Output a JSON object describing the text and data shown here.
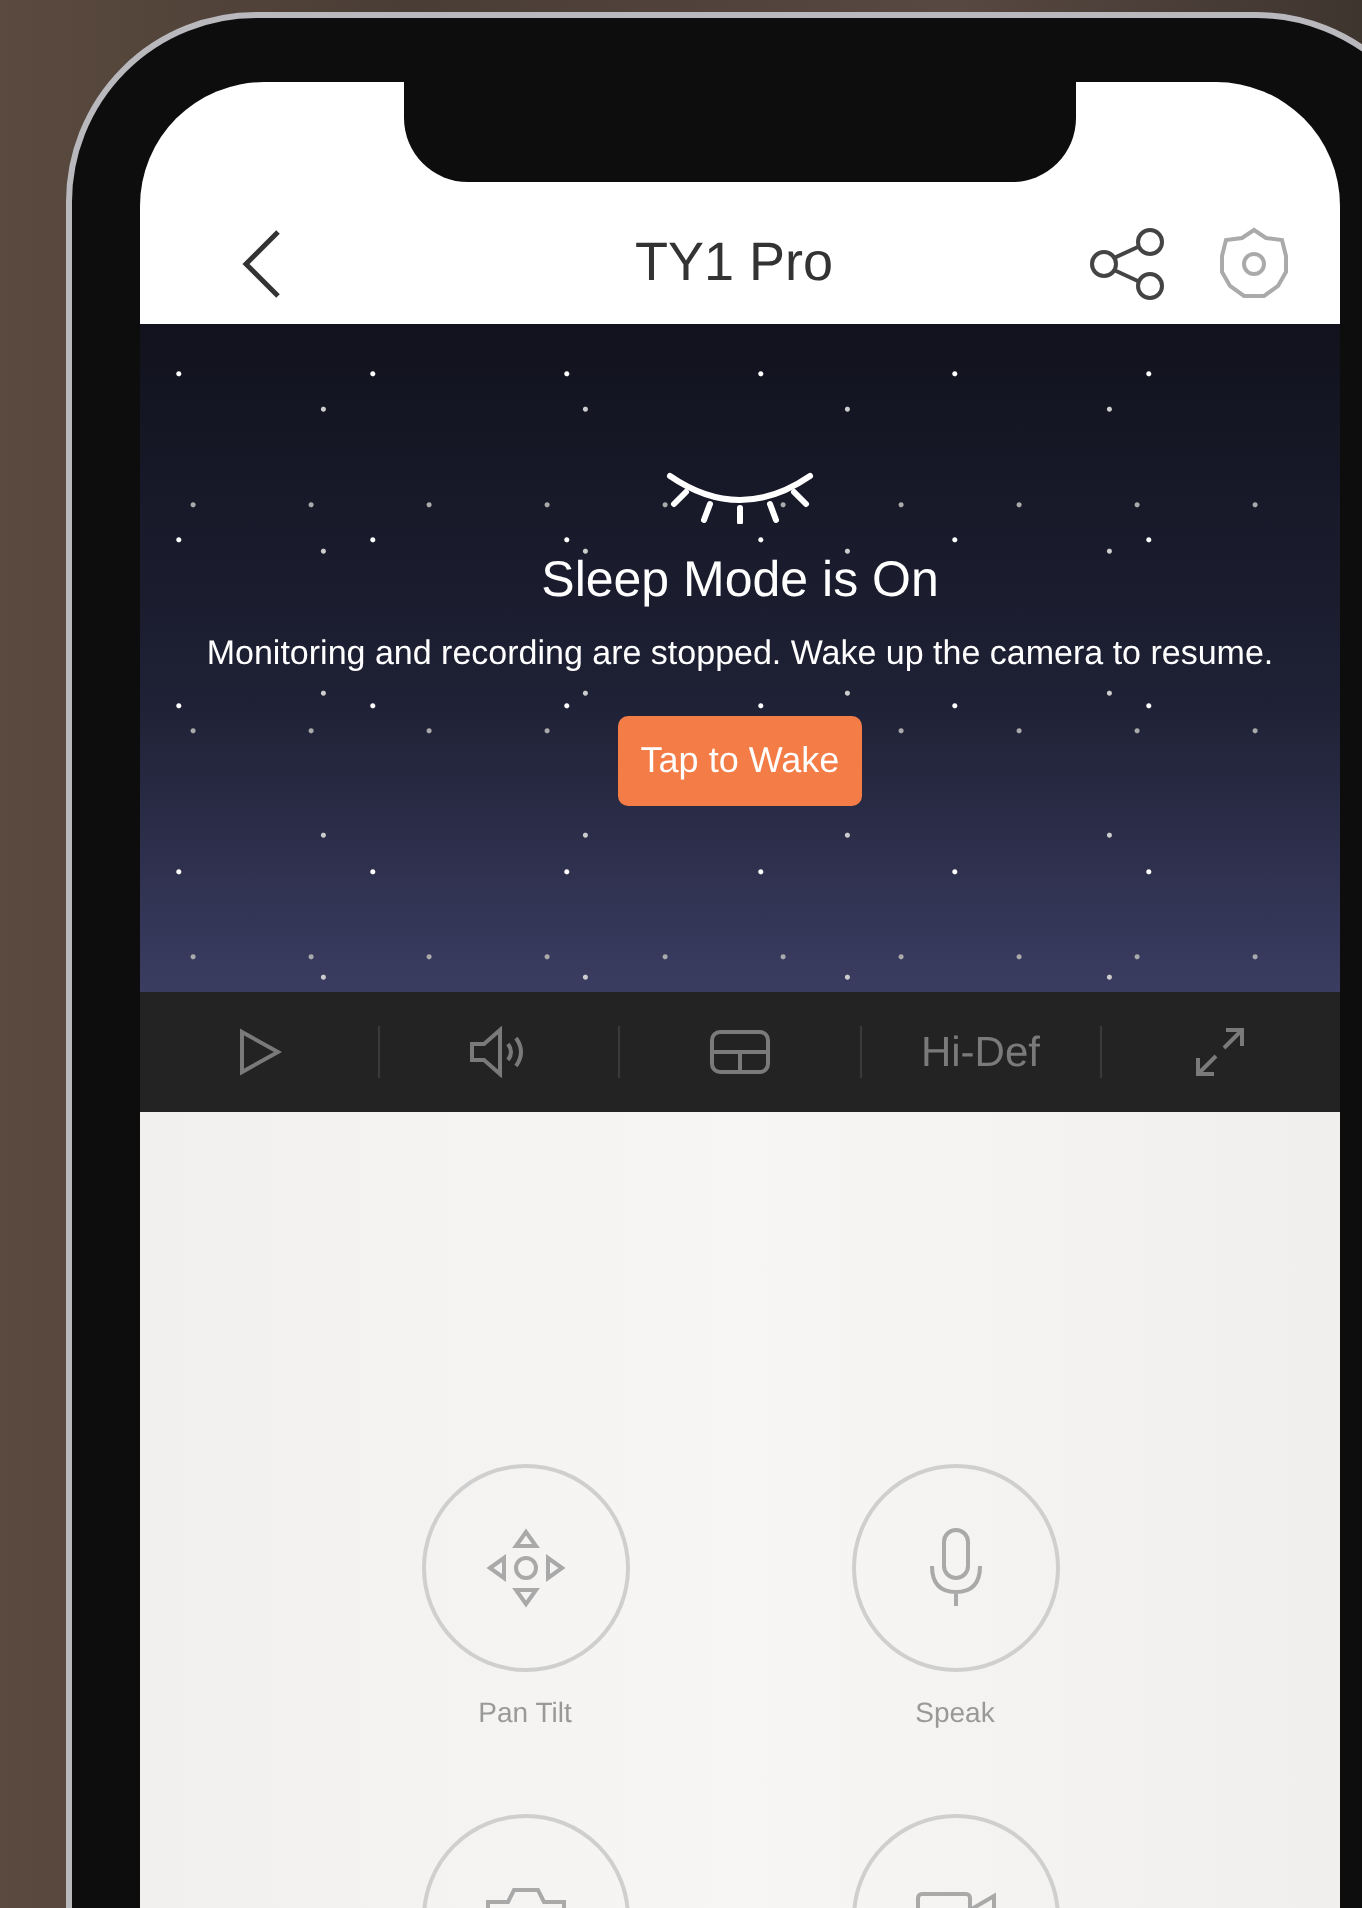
{
  "header": {
    "title": "TY1 Pro"
  },
  "sleep": {
    "title": "Sleep Mode is On",
    "message": "Monitoring and recording are stopped. Wake up the camera to resume.",
    "button": "Tap to Wake"
  },
  "toolbar": [
    {
      "kind": "play"
    },
    {
      "kind": "sound"
    },
    {
      "kind": "layout"
    },
    {
      "kind": "text",
      "label": "Hi-Def"
    },
    {
      "kind": "fullscreen"
    }
  ],
  "controls": [
    {
      "kind": "pantilt",
      "label": "Pan Tilt"
    },
    {
      "kind": "mic",
      "label": "Speak"
    },
    {
      "kind": "camera"
    },
    {
      "kind": "video"
    }
  ]
}
